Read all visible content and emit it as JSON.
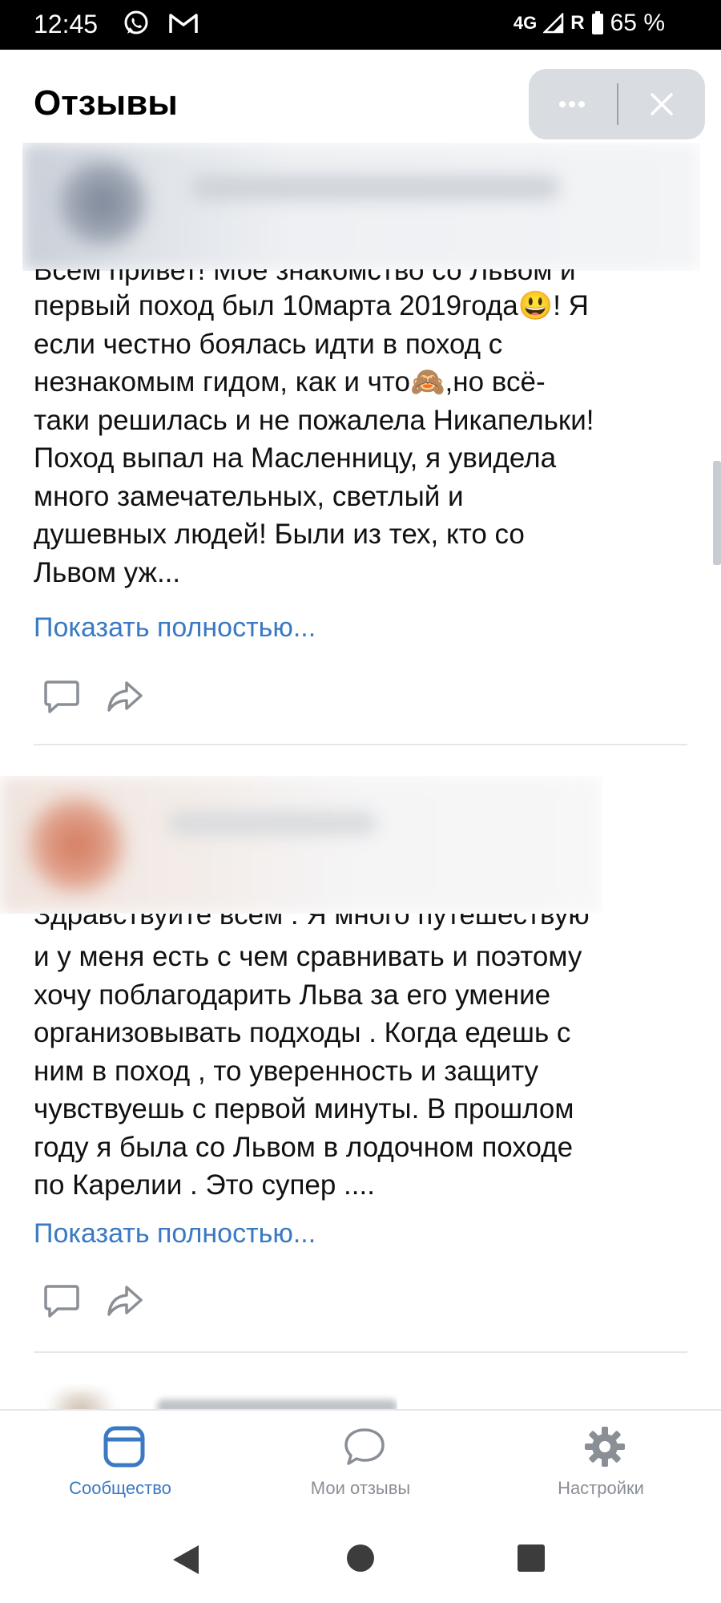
{
  "status_bar": {
    "time": "12:45",
    "network": "4G",
    "roaming": "R",
    "battery": "65 %",
    "icons": [
      "whatsapp-icon",
      "gmail-icon",
      "signal-icon",
      "battery-icon"
    ]
  },
  "header": {
    "title": "Отзывы",
    "more_icon": "more-icon",
    "close_icon": "close-icon"
  },
  "reviews": [
    {
      "cut_text": "Всем привет! Моё знакомство со Львом и",
      "lines": [
        "первый поход был 10марта 2019года😃! Я",
        "если честно боялась идти в поход с",
        "незнакомым гидом, как и что🙈,но всё-",
        "таки решилась и не пожалела Никапельки!",
        "Поход выпал на Масленницу, я увидела",
        "много замечательных, светлый и",
        "душевных людей! Были из тех, кто со",
        "Львом уж..."
      ],
      "show_more": "Показать полностью..."
    },
    {
      "cut_text": "Здравствуйте всем . Я много путешествую",
      "lines": [
        "и у меня есть с чем сравнивать и поэтому",
        "хочу поблагодарить Льва за его умение",
        "организовывать подходы . Когда едешь с",
        "ним в поход , то уверенность и защиту",
        "чувствуешь с первой минуты. В прошлом",
        "году я была со Львом в лодочном походе",
        "по Карелии . Это супер ...."
      ],
      "show_more": "Показать полностью..."
    }
  ],
  "bottom_nav": {
    "items": [
      {
        "label": "Сообщество",
        "icon": "community-icon",
        "active": true
      },
      {
        "label": "Мои отзывы",
        "icon": "chat-bubble-icon",
        "active": false
      },
      {
        "label": "Настройки",
        "icon": "gear-icon",
        "active": false
      }
    ]
  },
  "colors": {
    "accent": "#3a79c4",
    "status_bar": "#000000",
    "inactive": "#8a8f96"
  }
}
